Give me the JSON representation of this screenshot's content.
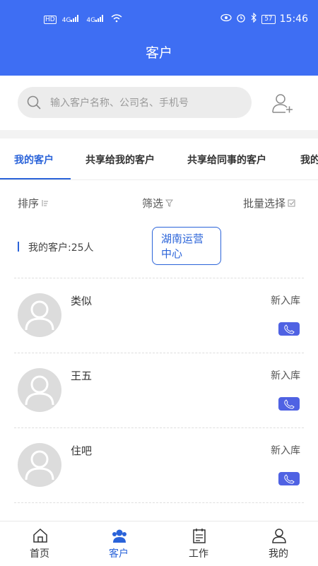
{
  "status_bar": {
    "left_text": [
      "HD",
      "4G",
      "4G"
    ],
    "battery": "57",
    "time": "15:46"
  },
  "header": {
    "title": "客户"
  },
  "search": {
    "placeholder": "输入客户名称、公司名、手机号"
  },
  "tabs": [
    {
      "label": "我的客户",
      "active": true
    },
    {
      "label": "共享给我的客户",
      "active": false
    },
    {
      "label": "共享给同事的客户",
      "active": false
    },
    {
      "label": "我的",
      "active": false
    }
  ],
  "filters": {
    "sort_label": "排序",
    "filter_label": "筛选",
    "batch_label": "批量选择"
  },
  "summary": {
    "count_text": "我的客户:25人",
    "org_tag": "湖南运营中心"
  },
  "customers": [
    {
      "name": "类似",
      "status": "新入库"
    },
    {
      "name": "王五",
      "status": "新入库"
    },
    {
      "name": "住吧",
      "status": "新入库"
    }
  ],
  "bottom_nav": [
    {
      "label": "首页",
      "icon": "home-icon",
      "active": false
    },
    {
      "label": "客户",
      "icon": "customers-icon",
      "active": true
    },
    {
      "label": "工作",
      "icon": "calendar-icon",
      "active": false
    },
    {
      "label": "我的",
      "icon": "profile-icon",
      "active": false
    }
  ],
  "colors": {
    "header": "#3e6ef3",
    "accent": "#2a63d9",
    "phone": "#4f62e3"
  }
}
